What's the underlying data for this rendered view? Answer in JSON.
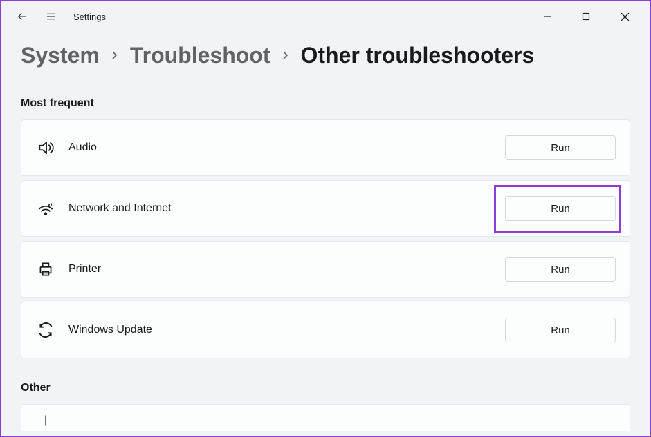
{
  "app": {
    "title": "Settings"
  },
  "breadcrumb": {
    "item1": "System",
    "item2": "Troubleshoot",
    "current": "Other troubleshooters"
  },
  "sections": {
    "most_frequent": {
      "title": "Most frequent",
      "rows": {
        "audio": {
          "label": "Audio",
          "button": "Run"
        },
        "network": {
          "label": "Network and Internet",
          "button": "Run"
        },
        "printer": {
          "label": "Printer",
          "button": "Run"
        },
        "update": {
          "label": "Windows Update",
          "button": "Run"
        }
      }
    },
    "other": {
      "title": "Other"
    }
  }
}
